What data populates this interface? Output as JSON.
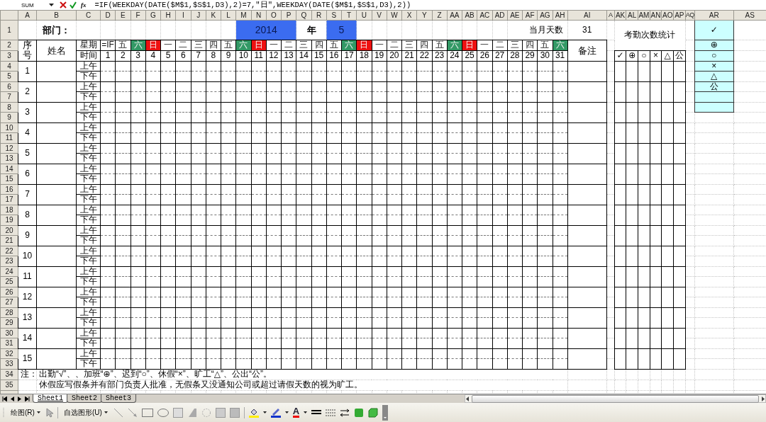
{
  "formula_bar": {
    "name_box": "SUM",
    "function_button": "fx",
    "formula": "=IF(WEEKDAY(DATE($M$1,$S$1,D3),2)=7,\"日\",WEEKDAY(DATE($M$1,$S$1,D3),2))"
  },
  "column_headers": [
    "A",
    "B",
    "C",
    "D",
    "E",
    "F",
    "G",
    "H",
    "I",
    "J",
    "K",
    "L",
    "M",
    "N",
    "O",
    "P",
    "Q",
    "R",
    "S",
    "T",
    "U",
    "V",
    "W",
    "X",
    "Y",
    "Z",
    "AA",
    "AB",
    "AC",
    "AD",
    "AE",
    "AF",
    "AG",
    "AH",
    "AI",
    "A",
    "AK",
    "AL",
    "AM",
    "AN",
    "AO",
    "AP",
    "AQ",
    "AR",
    "AS"
  ],
  "row_headers": [
    "1",
    "2",
    "3",
    "4",
    "5",
    "6",
    "7",
    "8",
    "9",
    "10",
    "11",
    "12",
    "13",
    "14",
    "15",
    "16",
    "17",
    "18",
    "19",
    "20",
    "21",
    "22",
    "23",
    "24",
    "25",
    "26",
    "27",
    "28",
    "29",
    "30",
    "31",
    "32",
    "33",
    "34",
    "35"
  ],
  "sheet": {
    "department_label": "部门：",
    "year": "2014",
    "year_label": "年",
    "month": "5",
    "days_in_month_label": "当月天数",
    "days_in_month": "31",
    "stats_title": "考勤次数统计",
    "header": {
      "number": "序号",
      "name": "姓名",
      "weekday_label": "星期",
      "time_label": "时间",
      "remarks": "备注",
      "weekdays": [
        {
          "label": "=IF",
          "color": "#ffffff"
        },
        {
          "label": "五",
          "color": "#ffffff"
        },
        {
          "label": "六",
          "color": "#339966"
        },
        {
          "label": "日",
          "color": "#ee1111"
        },
        {
          "label": "一",
          "color": "#ffffff"
        },
        {
          "label": "二",
          "color": "#ffffff"
        },
        {
          "label": "三",
          "color": "#ffffff"
        },
        {
          "label": "四",
          "color": "#ffffff"
        },
        {
          "label": "五",
          "color": "#ffffff"
        },
        {
          "label": "六",
          "color": "#339966"
        },
        {
          "label": "日",
          "color": "#ee1111"
        },
        {
          "label": "一",
          "color": "#ffffff"
        },
        {
          "label": "二",
          "color": "#ffffff"
        },
        {
          "label": "三",
          "color": "#ffffff"
        },
        {
          "label": "四",
          "color": "#ffffff"
        },
        {
          "label": "五",
          "color": "#ffffff"
        },
        {
          "label": "六",
          "color": "#339966"
        },
        {
          "label": "日",
          "color": "#ee1111"
        },
        {
          "label": "一",
          "color": "#ffffff"
        },
        {
          "label": "二",
          "color": "#ffffff"
        },
        {
          "label": "三",
          "color": "#ffffff"
        },
        {
          "label": "四",
          "color": "#ffffff"
        },
        {
          "label": "五",
          "color": "#ffffff"
        },
        {
          "label": "六",
          "color": "#339966"
        },
        {
          "label": "日",
          "color": "#ee1111"
        },
        {
          "label": "一",
          "color": "#ffffff"
        },
        {
          "label": "二",
          "color": "#ffffff"
        },
        {
          "label": "三",
          "color": "#ffffff"
        },
        {
          "label": "四",
          "color": "#ffffff"
        },
        {
          "label": "五",
          "color": "#ffffff"
        },
        {
          "label": "六",
          "color": "#339966"
        }
      ],
      "days": [
        "1",
        "2",
        "3",
        "4",
        "5",
        "6",
        "7",
        "8",
        "9",
        "10",
        "11",
        "12",
        "13",
        "14",
        "15",
        "16",
        "17",
        "18",
        "19",
        "20",
        "21",
        "22",
        "23",
        "24",
        "25",
        "26",
        "27",
        "28",
        "29",
        "30",
        "31"
      ],
      "stat_symbols": [
        "✓",
        "⊕",
        "○",
        "×",
        "△",
        "公"
      ]
    },
    "legend": [
      "✓",
      "⊕",
      "○",
      "×",
      "△",
      "公"
    ],
    "employees": [
      {
        "number": "1",
        "am": "上午",
        "pm": "下午"
      },
      {
        "number": "2",
        "am": "上午",
        "pm": "下午"
      },
      {
        "number": "3",
        "am": "上午",
        "pm": "下午"
      },
      {
        "number": "4",
        "am": "上午",
        "pm": "下午"
      },
      {
        "number": "5",
        "am": "上午",
        "pm": "下午"
      },
      {
        "number": "6",
        "am": "上午",
        "pm": "下午"
      },
      {
        "number": "7",
        "am": "上午",
        "pm": "下午"
      },
      {
        "number": "8",
        "am": "上午",
        "pm": "下午"
      },
      {
        "number": "9",
        "am": "上午",
        "pm": "下午"
      },
      {
        "number": "10",
        "am": "上午",
        "pm": "下午"
      },
      {
        "number": "11",
        "am": "上午",
        "pm": "下午"
      },
      {
        "number": "12",
        "am": "上午",
        "pm": "下午"
      },
      {
        "number": "13",
        "am": "上午",
        "pm": "下午"
      },
      {
        "number": "14",
        "am": "上午",
        "pm": "下午"
      },
      {
        "number": "15",
        "am": "上午",
        "pm": "下午"
      }
    ],
    "note_label": "注：",
    "notes": [
      "出勤“√”、、加班“⊕”、迟到“○”、休假“×”、旷工“△”、公出“公”。",
      "休假应写假条并有部门负责人批准，无假条又没通知公司或超过请假天数的视为旷工。"
    ]
  },
  "sheet_tabs": [
    {
      "label": "Sheet1",
      "selected": true
    },
    {
      "label": "Sheet2",
      "selected": false
    },
    {
      "label": "Sheet3",
      "selected": false
    }
  ],
  "drawing_toolbar": {
    "draw_menu": "绘图(R)",
    "autoshapes_menu": "自选图形(U)",
    "font_color_button": "A"
  }
}
